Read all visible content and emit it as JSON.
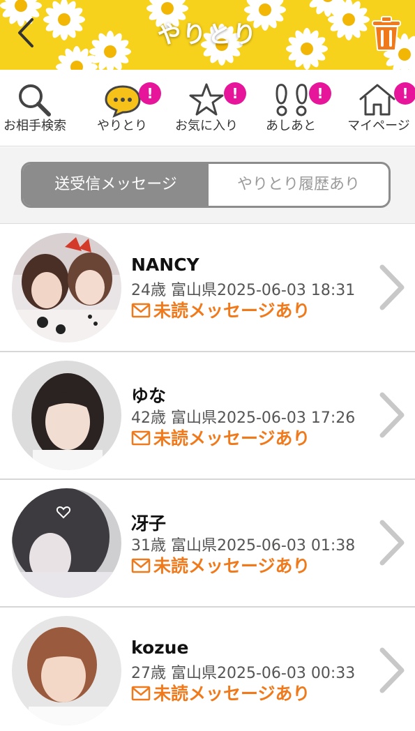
{
  "header": {
    "title": "やりとり",
    "colors": {
      "background": "#f7d21c",
      "trash": "#f07a1b"
    }
  },
  "nav": {
    "items": [
      {
        "label": "お相手検索",
        "icon": "search-icon",
        "badge": ""
      },
      {
        "label": "やりとり",
        "icon": "chat-bubble-icon",
        "badge": "!"
      },
      {
        "label": "お気に入り",
        "icon": "star-icon",
        "badge": "!"
      },
      {
        "label": "あしあと",
        "icon": "footprints-icon",
        "badge": "!"
      },
      {
        "label": "マイページ",
        "icon": "home-icon",
        "badge": "!"
      }
    ],
    "badge_color": "#e6159a"
  },
  "segmented": {
    "active": "送受信メッセージ",
    "inactive": "やりとり履歴あり"
  },
  "conversations": [
    {
      "name": "NANCY",
      "meta": "24歳 富山県2025-06-03 18:31",
      "status": "未読メッセージあり"
    },
    {
      "name": "ゆな",
      "meta": "42歳 富山県2025-06-03 17:26",
      "status": "未読メッセージあり"
    },
    {
      "name": "冴子",
      "meta": "31歳 富山県2025-06-03 01:38",
      "status": "未読メッセージあり"
    },
    {
      "name": "kozue",
      "meta": "27歳 富山県2025-06-03 00:33",
      "status": "未読メッセージあり"
    }
  ],
  "accent_color": "#f07a1b"
}
